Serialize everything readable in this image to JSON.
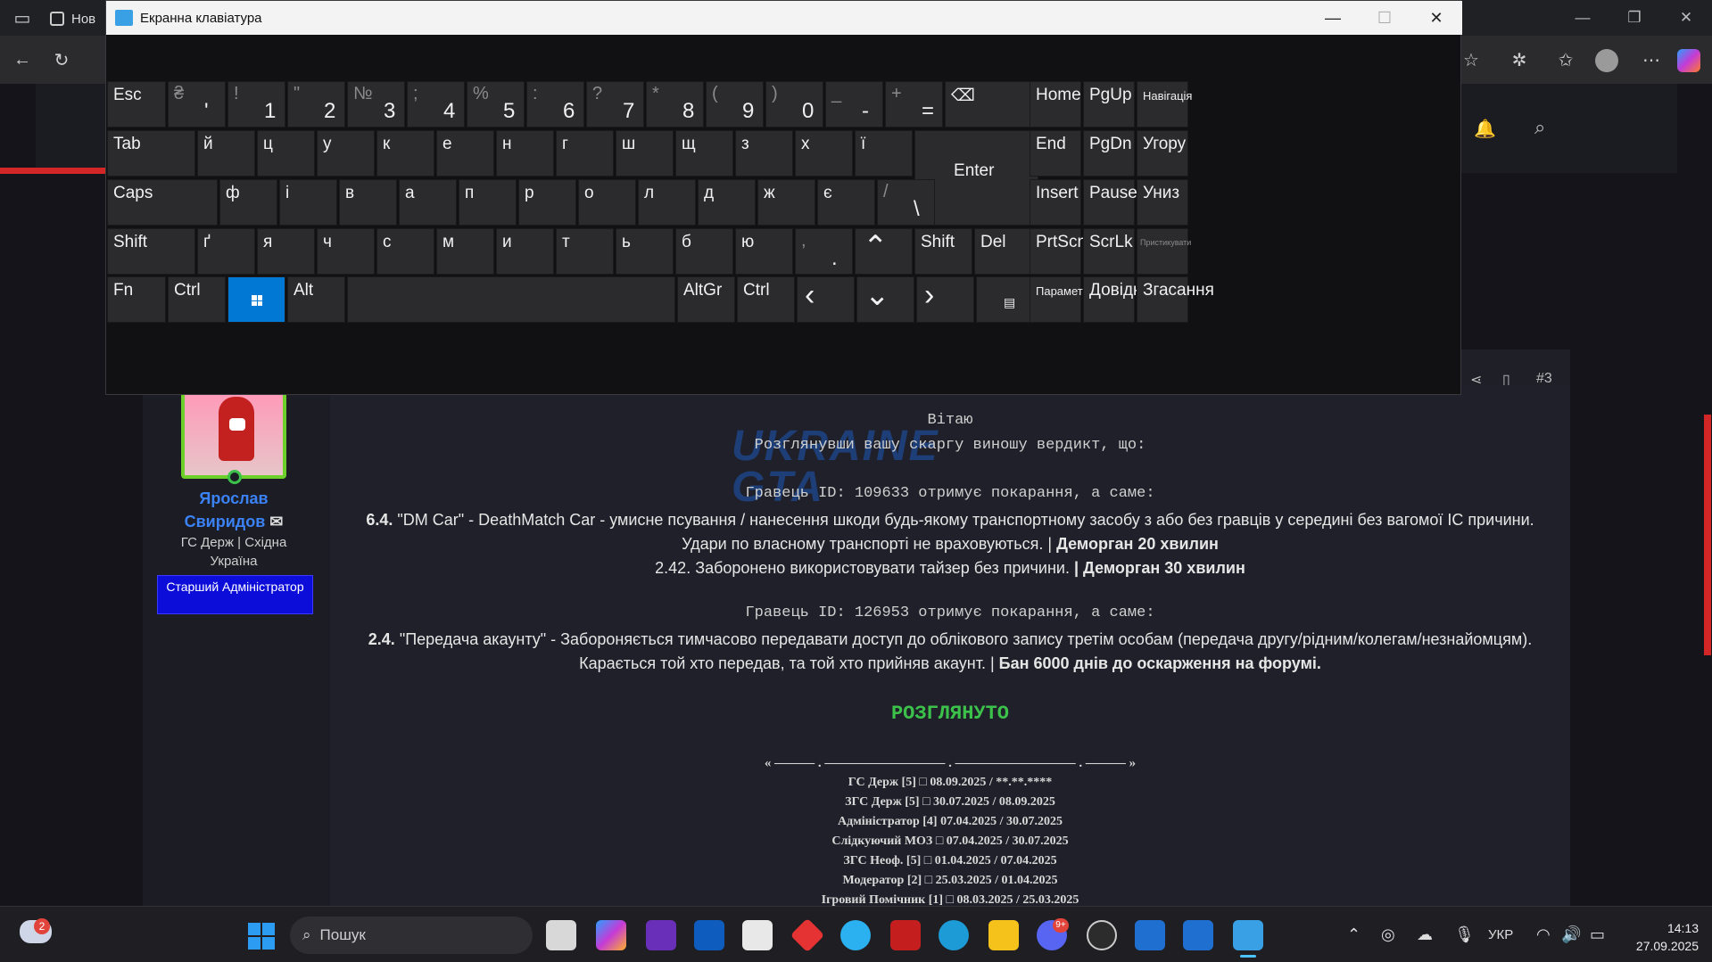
{
  "browser": {
    "tab_title": "Нов",
    "tab_icon": "tab-page-icon"
  },
  "keyboard": {
    "title": "Екранна клавіатура",
    "rows": [
      [
        {
          "k": "Esc",
          "t": "l"
        },
        {
          "s": "₴",
          "b": "'"
        },
        {
          "s": "!",
          "b": "1"
        },
        {
          "s": "\"",
          "b": "2"
        },
        {
          "s": "№",
          "b": "3"
        },
        {
          "s": ";",
          "b": "4"
        },
        {
          "s": "%",
          "b": "5"
        },
        {
          "s": ":",
          "b": "6"
        },
        {
          "s": "?",
          "b": "7"
        },
        {
          "s": "*",
          "b": "8"
        },
        {
          "s": "(",
          "b": "9"
        },
        {
          "s": ")",
          "b": "0"
        },
        {
          "s": "_",
          "b": "-"
        },
        {
          "s": "+",
          "b": "="
        },
        {
          "k": "⌫",
          "t": "l"
        }
      ],
      [
        {
          "k": "Tab"
        },
        {
          "k": "й"
        },
        {
          "k": "ц"
        },
        {
          "k": "у"
        },
        {
          "k": "к"
        },
        {
          "k": "е"
        },
        {
          "k": "н"
        },
        {
          "k": "г"
        },
        {
          "k": "ш"
        },
        {
          "k": "щ"
        },
        {
          "k": "з"
        },
        {
          "k": "х"
        },
        {
          "k": "ї"
        },
        {
          "k": "Enter"
        }
      ],
      [
        {
          "k": "Caps"
        },
        {
          "k": "ф"
        },
        {
          "k": "і"
        },
        {
          "k": "в"
        },
        {
          "k": "а"
        },
        {
          "k": "п"
        },
        {
          "k": "р"
        },
        {
          "k": "о"
        },
        {
          "k": "л"
        },
        {
          "k": "д"
        },
        {
          "k": "ж"
        },
        {
          "k": "є"
        },
        {
          "s": "/",
          "b": "\\"
        }
      ],
      [
        {
          "k": "Shift"
        },
        {
          "k": "ґ"
        },
        {
          "k": "я"
        },
        {
          "k": "ч"
        },
        {
          "k": "с"
        },
        {
          "k": "м"
        },
        {
          "k": "и"
        },
        {
          "k": "т"
        },
        {
          "k": "ь"
        },
        {
          "k": "б"
        },
        {
          "k": "ю"
        },
        {
          "s": ",",
          "b": "."
        },
        {
          "k": "^"
        },
        {
          "k": "Shift"
        },
        {
          "k": "Del"
        }
      ],
      [
        {
          "k": "Fn"
        },
        {
          "k": "Ctrl"
        },
        {
          "k": "win"
        },
        {
          "k": "Alt"
        },
        {
          "k": ""
        },
        {
          "k": "AltGr"
        },
        {
          "k": "Ctrl"
        },
        {
          "k": "<"
        },
        {
          "k": "v"
        },
        {
          "k": ">"
        },
        {
          "k": "menu"
        }
      ]
    ],
    "nav": [
      [
        "Home",
        "PgUp",
        "Навігація"
      ],
      [
        "End",
        "PgDn",
        "Угору"
      ],
      [
        "Insert",
        "Pause",
        "Униз"
      ],
      [
        "PrtScn",
        "ScrLk",
        "Пристикувати"
      ],
      [
        "Параметри",
        "Довідка",
        "Згасання"
      ]
    ]
  },
  "post": {
    "number": "#3",
    "user_name_1": "Ярослав",
    "user_name_2": "Свиридов",
    "user_group": "ГС Держ | Східна Україна",
    "user_rank": "Старший Адміністратор",
    "greeting": "Вітаю",
    "intro": "Розглянувши вашу скаргу виношу вердикт, що:",
    "player1": "Гравець ID: 109633 отримує покарання, а саме:",
    "rule1_num": "6.4.",
    "rule1_text": " \"DM Car\" - DeathMatch Car - умисне псування / нанесення шкоди будь-якому транспортному засобу з або без гравців у середині без вагомої IC причини. Удари по власному транспорті не враховуються. | ",
    "rule1_pen": "Деморган 20 хвилин",
    "rule2_text": "2.42. Заборонено використовувати тайзер без причини. ",
    "rule2_pen": "| Деморган 30 хвилин",
    "player2": "Гравець ID: 126953 отримує покарання, а саме:",
    "rule3_num": "2.4.",
    "rule3_text": " \"Передача акаунту\" - Забороняється тимчасово передавати доступ до облікового запису третім особам (передача другу/рідним/колегам/незнайомцям). Карається той хто передав, та той хто прийняв акаунт. | ",
    "rule3_pen": "Бан 6000 днів до оскарження на форумі.",
    "status": "РОЗГЛЯНУТО",
    "divider": "« ——— . ————————— . ————————— . ——— »",
    "history": [
      "ГС Держ [5] □ 08.09.2025 / **.**.****",
      "ЗГС Держ [5] □ 30.07.2025 / 08.09.2025",
      "Адміністратор [4] 07.04.2025 / 30.07.2025",
      "Слідкуючий МОЗ □ 07.04.2025 / 30.07.2025",
      "ЗГС Неоф. [5] □ 01.04.2025 / 07.04.2025",
      "Модератор [2] □ 25.03.2025 / 01.04.2025",
      "Ігровий Помічник [1] □ 08.03.2025 / 25.03.2025"
    ],
    "watermark": "UKRAINE GTA"
  },
  "taskbar": {
    "search_placeholder": "Пошук",
    "weather_badge": "2",
    "discord_badge": "9+",
    "lang": "УКР",
    "time": "14:13",
    "date": "27.09.2025"
  }
}
